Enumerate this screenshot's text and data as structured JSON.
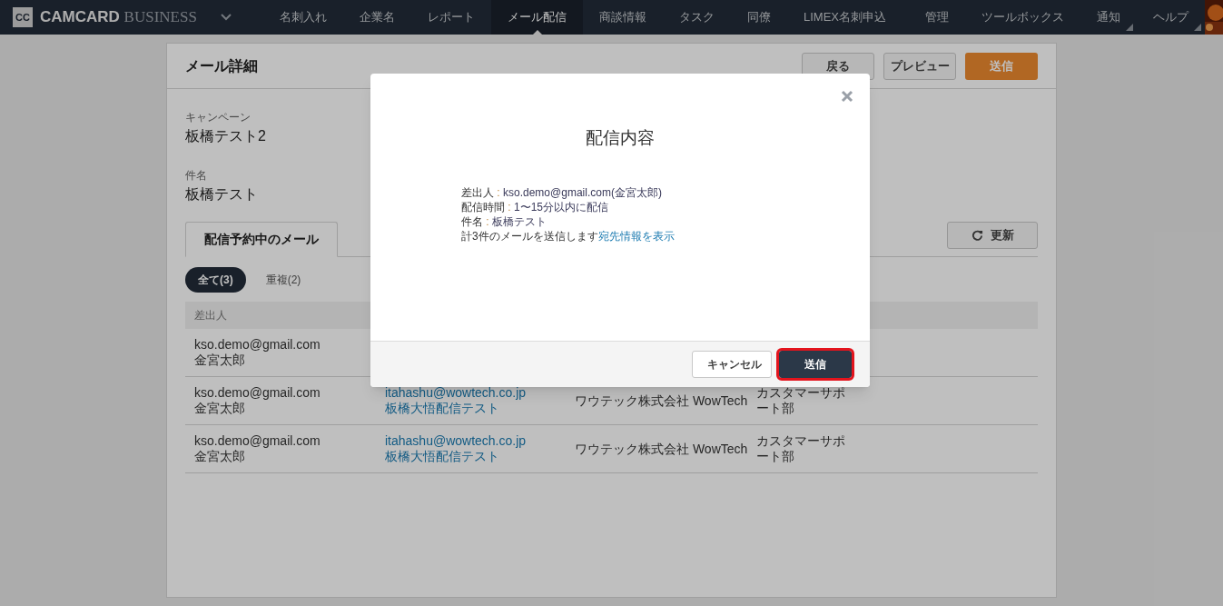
{
  "nav": {
    "logo_mark": "CC",
    "brand_bold": "CAMCARD",
    "brand_light": "BUSINESS",
    "items": [
      {
        "label": "名刺入れ",
        "selected": false
      },
      {
        "label": "企業名",
        "selected": false
      },
      {
        "label": "レポート",
        "selected": false
      },
      {
        "label": "メール配信",
        "selected": true
      },
      {
        "label": "商談情報",
        "selected": false
      },
      {
        "label": "タスク",
        "selected": false
      },
      {
        "label": "同僚",
        "selected": false
      },
      {
        "label": "LIMEX名刺申込",
        "selected": false
      }
    ],
    "right_items": [
      {
        "label": "管理",
        "menu": false
      },
      {
        "label": "ツールボックス",
        "menu": false
      },
      {
        "label": "通知",
        "menu": true
      },
      {
        "label": "ヘルプ",
        "menu": true
      }
    ]
  },
  "page": {
    "title": "メール詳細",
    "buttons": [
      {
        "label": "戻る",
        "kind": "plain"
      },
      {
        "label": "プレビュー",
        "kind": "plain"
      },
      {
        "label": "送信",
        "kind": "primary"
      }
    ],
    "fields": [
      {
        "label": "キャンペーン",
        "value": "板橋テスト2"
      },
      {
        "label": "件名",
        "value": "板橋テスト"
      }
    ],
    "tabs": [
      {
        "label": "配信予約中のメール",
        "selected": true
      }
    ],
    "refresh_button": "更新",
    "filters": [
      {
        "label": "全て(3)",
        "selected": true
      },
      {
        "label": "重複(2)",
        "selected": false
      }
    ],
    "table": {
      "columns": [
        "差出人"
      ],
      "rows": [
        {
          "sender_email": "kso.demo@gmail.com",
          "sender_name": "金宮太郎"
        },
        {
          "sender_email": "kso.demo@gmail.com",
          "sender_name": "金宮太郎",
          "recipient_email": "itahashu@wowtech.co.jp",
          "campaign": "板橋大悟配信テスト",
          "company": "ワウテック株式会社 WowTech",
          "department": "カスタマーサポート部"
        },
        {
          "sender_email": "kso.demo@gmail.com",
          "sender_name": "金宮太郎",
          "recipient_email": "itahashu@wowtech.co.jp",
          "campaign": "板橋大悟配信テスト",
          "company": "ワウテック株式会社 WowTech",
          "department": "カスタマーサポート部"
        }
      ]
    }
  },
  "dialog": {
    "title": "配信内容",
    "lines": [
      {
        "label": "差出人",
        "separator": " : ",
        "value": "kso.demo@gmail.com(金宮太郎)"
      },
      {
        "label": "配信時間",
        "separator": " : ",
        "value": "1〜15分以内に配信"
      },
      {
        "label": "件名",
        "separator": " : ",
        "value": "板橋テスト"
      }
    ],
    "summary": "計3件のメールを送信します",
    "summary_link": "宛先情報を表示",
    "buttons": [
      {
        "label": "キャンセル",
        "kind": "plain",
        "focused": false
      },
      {
        "label": "送信",
        "kind": "primary",
        "focused": true
      }
    ]
  }
}
